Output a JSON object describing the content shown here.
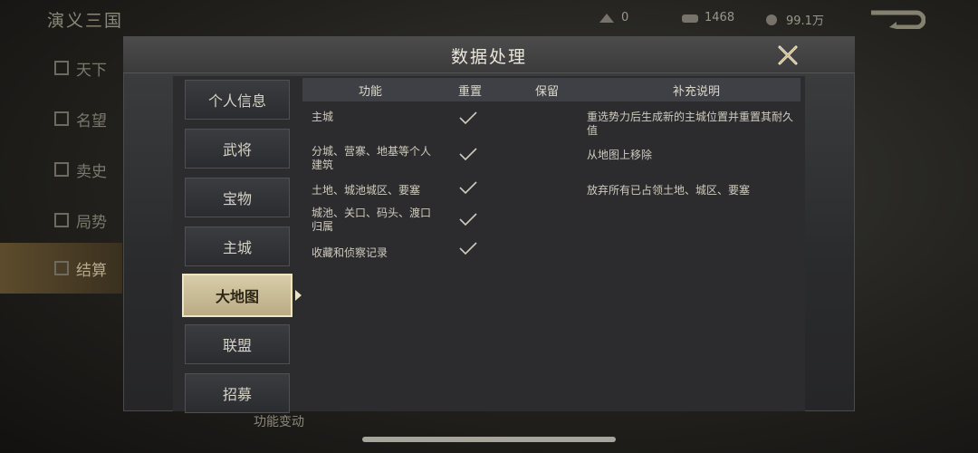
{
  "background": {
    "game_title": "演义三国",
    "resources": [
      {
        "icon": "gold-icon",
        "value": "0"
      },
      {
        "icon": "jade-icon",
        "value": "1468"
      },
      {
        "icon": "copper-icon",
        "value": "99.1万"
      }
    ],
    "side_items": [
      {
        "icon": "book-icon",
        "label": "天下"
      },
      {
        "icon": "tower-icon",
        "label": "名望"
      },
      {
        "icon": "scroll-icon",
        "label": "卖史"
      },
      {
        "icon": "chess-icon",
        "label": "局势"
      },
      {
        "icon": "grid-icon",
        "label": "结算"
      }
    ],
    "bottom_label": "功能变动"
  },
  "dialog": {
    "title": "数据处理",
    "tabs": [
      "个人信息",
      "武将",
      "宝物",
      "主城",
      "大地图",
      "联盟",
      "招募"
    ],
    "active_tab": "大地图",
    "table": {
      "headers": [
        "功能",
        "重置",
        "保留",
        "补充说明"
      ],
      "rows": [
        {
          "function": "主城",
          "reset": true,
          "keep": false,
          "note": "重选势力后生成新的主城位置并重置其耐久值"
        },
        {
          "function": "分城、营寨、地基等个人建筑",
          "reset": true,
          "keep": false,
          "note": "从地图上移除"
        },
        {
          "function": "土地、城池城区、要塞",
          "reset": true,
          "keep": false,
          "note": "放弃所有已占领土地、城区、要塞"
        },
        {
          "function": "城池、关口、码头、渡口归属",
          "reset": true,
          "keep": false,
          "note": ""
        },
        {
          "function": "收藏和侦察记录",
          "reset": true,
          "keep": false,
          "note": ""
        }
      ]
    }
  },
  "colors": {
    "active_tab": "#cfc39d",
    "header_bg": "#3e4045",
    "dialog_bg": "#2c2c2e"
  }
}
